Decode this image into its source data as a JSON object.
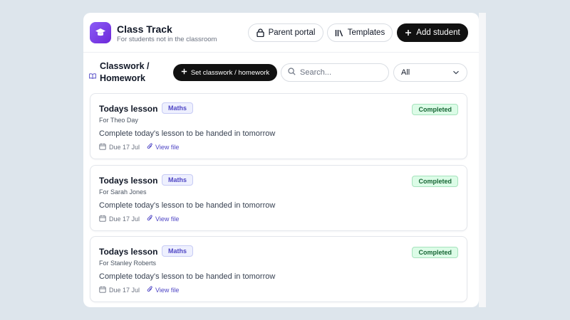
{
  "app": {
    "title": "Class Track",
    "subtitle": "For students not in the classroom",
    "logo_icon": "graduation-cap-icon",
    "accent": "#7c3aed"
  },
  "header": {
    "parent_portal_label": "Parent portal",
    "templates_label": "Templates",
    "add_student_label": "Add student"
  },
  "toolbar": {
    "section_title": "Classwork / Homework",
    "set_button_label": "Set classwork / homework",
    "search_placeholder": "Search...",
    "filter_value": "All"
  },
  "assignments": [
    {
      "title": "Todays lesson",
      "subject": "Maths",
      "student": "For Theo Day",
      "description": "Complete today's lesson to be handed in tomorrow",
      "due": "Due 17 Jul",
      "file_label": "View file",
      "status": "Completed"
    },
    {
      "title": "Todays lesson",
      "subject": "Maths",
      "student": "For Sarah Jones",
      "description": "Complete today's lesson to be handed in tomorrow",
      "due": "Due 17 Jul",
      "file_label": "View file",
      "status": "Completed"
    },
    {
      "title": "Todays lesson",
      "subject": "Maths",
      "student": "For Stanley Roberts",
      "description": "Complete today's lesson to be handed in tomorrow",
      "due": "Due 17 Jul",
      "file_label": "View file",
      "status": "Completed"
    }
  ]
}
